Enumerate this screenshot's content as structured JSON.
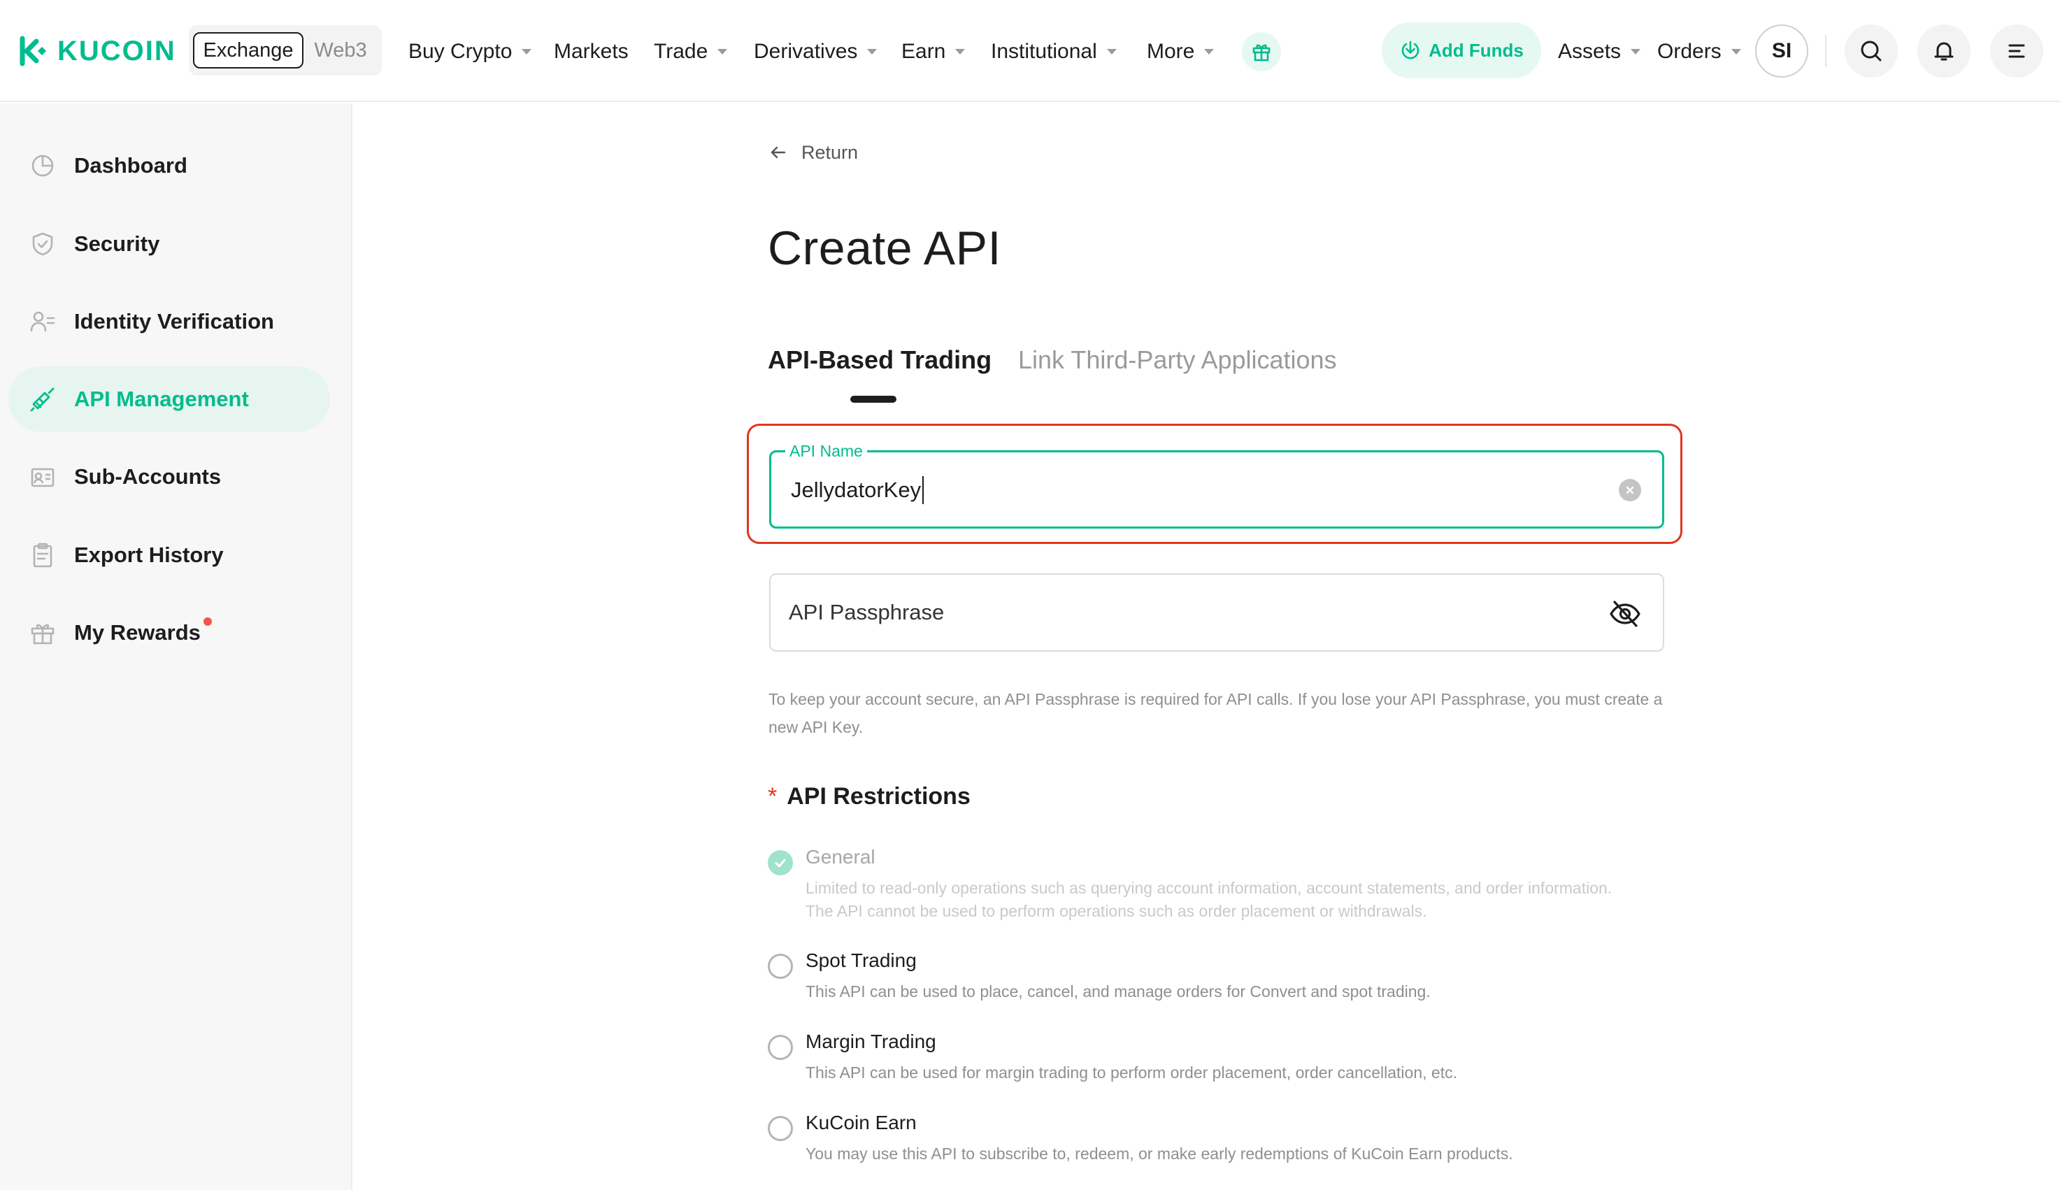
{
  "brand": {
    "name": "KUCOIN",
    "accent": "#01bc8d",
    "highlight": "#e0361f"
  },
  "header": {
    "mode_exchange": "Exchange",
    "mode_web3": "Web3",
    "nav": [
      {
        "label": "Buy Crypto",
        "dropdown": true
      },
      {
        "label": "Markets",
        "dropdown": false
      },
      {
        "label": "Trade",
        "dropdown": true
      },
      {
        "label": "Derivatives",
        "dropdown": true
      },
      {
        "label": "Earn",
        "dropdown": true
      },
      {
        "label": "Institutional",
        "dropdown": true
      },
      {
        "label": "More",
        "dropdown": true
      }
    ],
    "add_funds": "Add Funds",
    "assets": "Assets",
    "orders": "Orders",
    "avatar_initials": "SI",
    "icons": [
      "gift-icon",
      "search-icon",
      "bell-icon",
      "menu-icon"
    ]
  },
  "sidebar": {
    "items": [
      {
        "label": "Dashboard",
        "icon": "pie-chart-icon",
        "active": false
      },
      {
        "label": "Security",
        "icon": "shield-icon",
        "active": false
      },
      {
        "label": "Identity Verification",
        "icon": "id-user-icon",
        "active": false
      },
      {
        "label": "API Management",
        "icon": "api-link-icon",
        "active": true
      },
      {
        "label": "Sub-Accounts",
        "icon": "sub-accounts-icon",
        "active": false
      },
      {
        "label": "Export History",
        "icon": "clipboard-icon",
        "active": false
      },
      {
        "label": "My Rewards",
        "icon": "gift-icon",
        "active": false,
        "badge_dot": true
      }
    ]
  },
  "main": {
    "return_label": "Return",
    "title": "Create API",
    "tabs": [
      {
        "label": "API-Based Trading",
        "active": true
      },
      {
        "label": "Link Third-Party Applications",
        "active": false
      }
    ],
    "api_name": {
      "label": "API Name",
      "value": "JellydatorKey"
    },
    "api_passphrase": {
      "placeholder": "API Passphrase"
    },
    "passphrase_hint": "To keep your account secure, an API Passphrase is required for API calls. If you lose your API Passphrase, you must create a new API Key.",
    "restrictions": {
      "title": "API Restrictions",
      "required_mark": "*",
      "options": [
        {
          "title": "General",
          "description": "Limited to read-only operations such as querying account information, account statements, and order information. The API cannot be used to perform operations such as order placement or withdrawals.",
          "checked": true,
          "disabled": true
        },
        {
          "title": "Spot Trading",
          "description": "This API can be used to place, cancel, and manage orders for Convert and spot trading.",
          "checked": false,
          "disabled": false
        },
        {
          "title": "Margin Trading",
          "description": "This API can be used for margin trading to perform order placement, order cancellation, etc.",
          "checked": false,
          "disabled": false
        },
        {
          "title": "KuCoin Earn",
          "description": "You may use this API to subscribe to, redeem, or make early redemptions of KuCoin Earn products.",
          "checked": false,
          "disabled": false
        }
      ]
    }
  }
}
